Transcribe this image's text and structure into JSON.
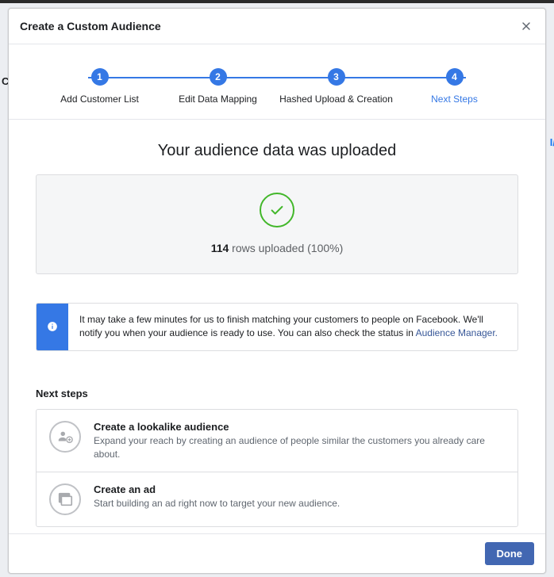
{
  "backdrop": {
    "side_text": "I/",
    "side_letter": "C"
  },
  "modal": {
    "title": "Create a Custom Audience"
  },
  "stepper": {
    "steps": [
      {
        "num": "1",
        "label": "Add Customer List"
      },
      {
        "num": "2",
        "label": "Edit Data Mapping"
      },
      {
        "num": "3",
        "label": "Hashed Upload & Creation"
      },
      {
        "num": "4",
        "label": "Next Steps"
      }
    ]
  },
  "result": {
    "headline": "Your audience data was uploaded",
    "rows": "114",
    "rows_suffix": " rows uploaded (100%)"
  },
  "info": {
    "text": "It may take a few minutes for us to finish matching your customers to people on Facebook. We'll notify you when your audience is ready to use. You can also check the status in ",
    "link": "Audience Manager."
  },
  "next_steps": {
    "title": "Next steps",
    "options": [
      {
        "title": "Create a lookalike audience",
        "desc": "Expand your reach by creating an audience of people similar the customers you already care about."
      },
      {
        "title": "Create an ad",
        "desc": "Start building an ad right now to target your new audience."
      }
    ]
  },
  "footer": {
    "done": "Done"
  }
}
